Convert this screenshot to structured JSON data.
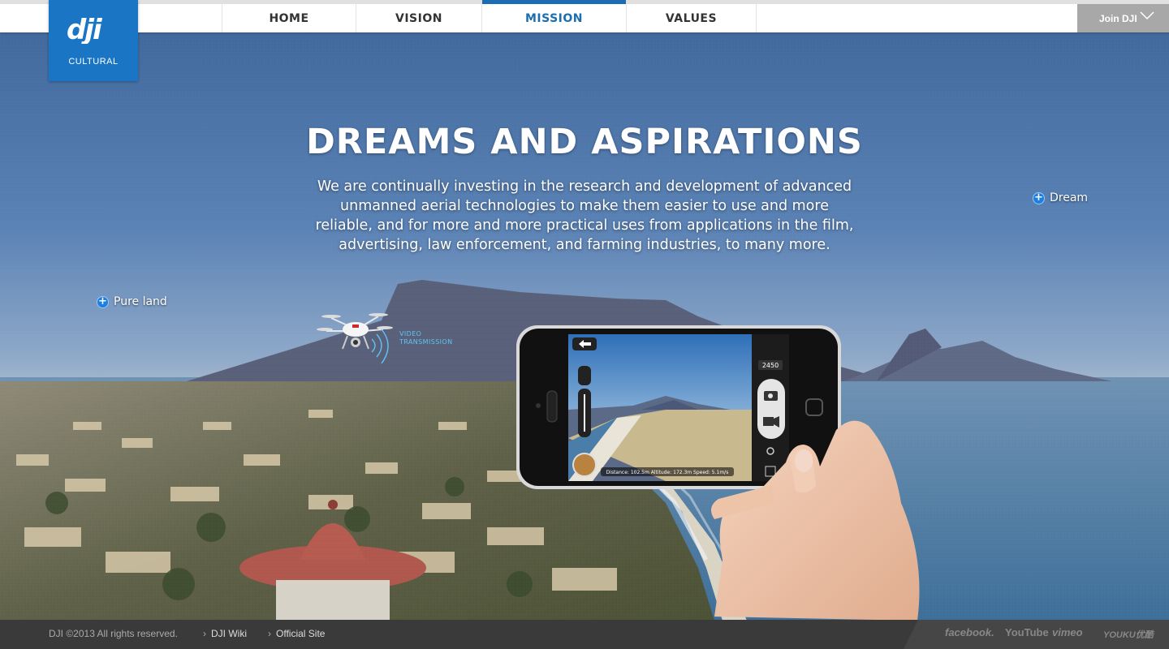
{
  "brand": {
    "logo_text": "dji",
    "subtitle": "CULTURAL",
    "accent": "#1a75c5"
  },
  "nav": {
    "items": [
      {
        "label": "HOME",
        "active": false
      },
      {
        "label": "VISION",
        "active": false
      },
      {
        "label": "MISSION",
        "active": true
      },
      {
        "label": "VALUES",
        "active": false
      }
    ],
    "join_label": "Join DJI"
  },
  "hero": {
    "title": "DREAMS AND ASPIRATIONS",
    "body_lines": [
      "We are continually investing in the research and development of advanced",
      "unmanned aerial technologies to make them easier to use and more",
      "reliable, and for more and more practical uses from applications in the film,",
      "advertising, law enforcement, and farming industries, to many more."
    ]
  },
  "hotspots": {
    "dream": "Dream",
    "pure_land": "Pure land"
  },
  "drone": {
    "label_line1": "VIDEO",
    "label_line2": "TRANSMISSION"
  },
  "phone_app": {
    "counter": "2450",
    "telemetry": "Distance: 102.5m   Altitude: 172.3m   Speed: 5.1m/s"
  },
  "footer": {
    "copyright": "DJI ©2013 All rights reserved.",
    "links": [
      "DJI Wiki",
      "Official Site"
    ],
    "social": [
      "facebook.",
      "YouTube",
      "vimeo",
      "YOUKU优酷"
    ]
  }
}
